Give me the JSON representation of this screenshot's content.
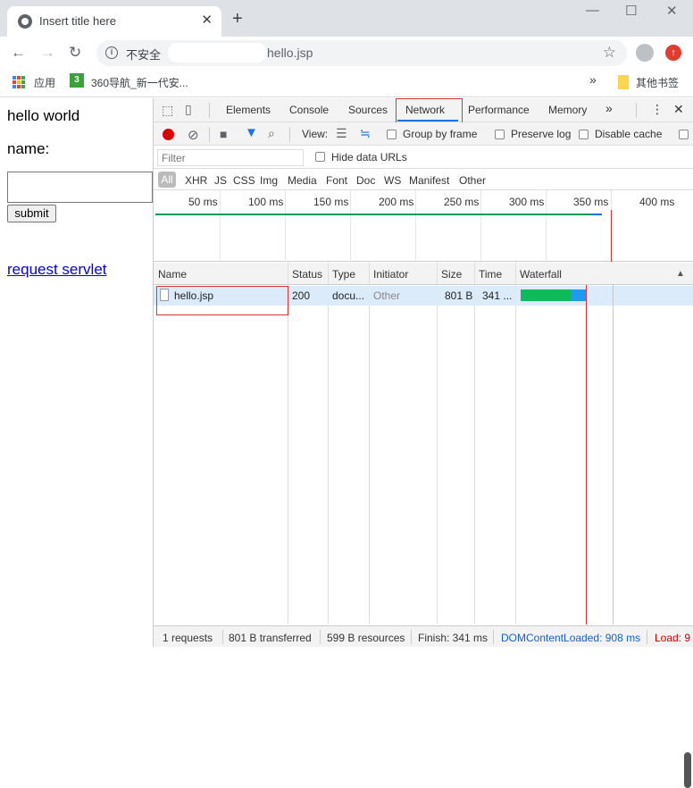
{
  "browser": {
    "tab_title": "Insert title here",
    "tab_close": "✕",
    "new_tab": "+",
    "window": {
      "minimize": "—",
      "maximize": "☐",
      "close": "✕"
    },
    "nav": {
      "back": "←",
      "forward": "→",
      "reload": "↻"
    },
    "address": {
      "security_label": "不安全",
      "path": "hello.jsp"
    },
    "bookmarks": [
      {
        "label": "应用"
      },
      {
        "label": "360导航_新一代安..."
      }
    ],
    "bookmarks_overflow": "»",
    "other_bookmarks": "其他书签"
  },
  "page": {
    "heading": "hello world",
    "name_label": "name:",
    "submit_label": "submit",
    "link_text": "request servlet"
  },
  "devtools": {
    "tabs": [
      "Elements",
      "Console",
      "Sources",
      "Network",
      "Performance",
      "Memory"
    ],
    "active_tab": "Network",
    "more_tabs": "»",
    "menu": "⋮",
    "close": "✕",
    "toolbar": {
      "view_label": "View:",
      "group_by_frame": "Group by frame",
      "preserve_log": "Preserve log",
      "disable_cache": "Disable cache"
    },
    "filter": {
      "placeholder": "Filter",
      "hide_data_urls": "Hide data URLs"
    },
    "type_filters": [
      "All",
      "XHR",
      "JS",
      "CSS",
      "Img",
      "Media",
      "Font",
      "Doc",
      "WS",
      "Manifest",
      "Other"
    ],
    "overview_ticks": [
      "50 ms",
      "100 ms",
      "150 ms",
      "200 ms",
      "250 ms",
      "300 ms",
      "350 ms",
      "400 ms"
    ],
    "columns": [
      "Name",
      "Status",
      "Type",
      "Initiator",
      "Size",
      "Time",
      "Waterfall"
    ],
    "sort_indicator": "▲",
    "requests": [
      {
        "name": "hello.jsp",
        "status": "200",
        "type": "docu...",
        "initiator": "Other",
        "size": "801 B",
        "time": "341 ..."
      }
    ],
    "status_bar": {
      "requests": "1 requests",
      "transferred": "801 B transferred",
      "resources": "599 B resources",
      "finish": "Finish: 341 ms",
      "dom_content_loaded": "DOMContentLoaded: 908 ms",
      "load": "Load: 9"
    },
    "colors": {
      "accent": "#1a73e8",
      "record": "#dd0000",
      "highlight_box": "#dd3333"
    }
  }
}
